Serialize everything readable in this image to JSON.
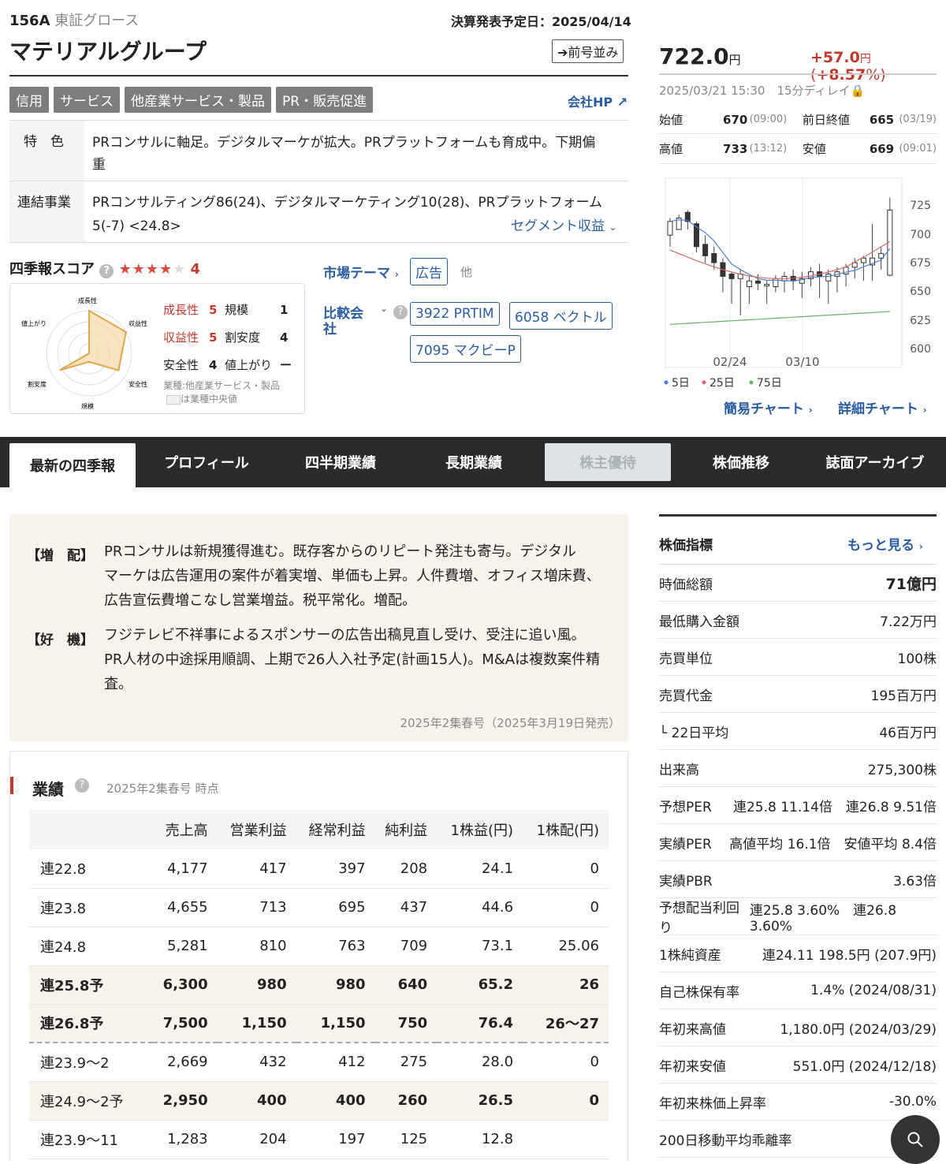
{
  "header": {
    "code": "156A",
    "market": "東証グロース",
    "name": "マテリアルグループ",
    "earnings_date": "決算発表予定日：2025/04/14",
    "prev_issue_btn": "前号並み",
    "tags": [
      "信用",
      "サービス",
      "他産業サービス・製品",
      "PR・販売促進"
    ],
    "company_hp": "会社HP"
  },
  "features": {
    "label": "特　色",
    "text1": "PRコンサルに軸足。デジタルマーケが拡大。PRプラットフォームも育成中。下期偏",
    "text2": "重"
  },
  "business": {
    "label": "連結事業",
    "text1": "PRコンサルティング86(24)、デジタルマーケティング10(28)、PRプラットフォーム",
    "text2": "5(-7) <24.8>",
    "segment_link": "セグメント収益"
  },
  "score": {
    "title": "四季報スコア",
    "total": "4",
    "items": [
      {
        "label": "成長性",
        "val": "5",
        "red": true
      },
      {
        "label": "規模",
        "val": "1"
      },
      {
        "label": "収益性",
        "val": "5",
        "red": true
      },
      {
        "label": "割安度",
        "val": "4"
      },
      {
        "label": "安全性",
        "val": "4"
      },
      {
        "label": "値上がり",
        "val": "ー"
      }
    ],
    "industry": "業種:他産業サービス・製品",
    "median_note": "は業種中央値",
    "radar_labels": {
      "growth": "成長性",
      "profit": "収益性",
      "safety": "安全性",
      "scale": "規模",
      "cheap": "割安度",
      "rise": "値上がり"
    }
  },
  "theme": {
    "label": "市場テーマ",
    "chip": "広告",
    "other": "他"
  },
  "compare": {
    "label1": "比較会",
    "label2": "社",
    "chips": [
      "3922 PRTIM",
      "6058 ベクトル",
      "7095 マクビーP"
    ]
  },
  "price": {
    "value": "722.0",
    "unit": "円",
    "change": "+57.0",
    "change_unit": "円",
    "pct_open": "(",
    "pct": "+8.57",
    "pct_close": "%)",
    "time": "2025/03/21 15:30",
    "delay": "15分ディレイ",
    "open_label": "始値",
    "open": "670",
    "open_time": "(09:00)",
    "prev_label": "前日終値",
    "prev": "665",
    "prev_date": "(03/19)",
    "high_label": "高値",
    "high": "733",
    "high_time": "(13:12)",
    "low_label": "安値",
    "low": "669",
    "low_time": "(09:01)"
  },
  "chart": {
    "y_ticks": [
      "725",
      "700",
      "675",
      "650",
      "625",
      "600"
    ],
    "x_ticks": [
      "02/24",
      "03/10"
    ],
    "legend": [
      "5日",
      "25日",
      "75日"
    ],
    "simple": "簡易チャート",
    "detail": "詳細チャート"
  },
  "tabs": [
    "最新の四季報",
    "プロフィール",
    "四半期業績",
    "長期業績",
    "株主優待",
    "株価推移",
    "誌面アーカイブ"
  ],
  "news": {
    "items": [
      {
        "label": "【増　配】",
        "lines": [
          "PRコンサルは新規獲得進む。既存客からのリピート発注も寄与。デジタル",
          "マーケは広告運用の案件が着実増、単価も上昇。人件費増、オフィス増床費、",
          "広告宣伝費増こなし営業増益。税平常化。増配。"
        ]
      },
      {
        "label": "【好　機】",
        "lines": [
          "フジテレビ不祥事によるスポンサーの広告出稿見直し受け、受注に追い風。",
          "PR人材の中途採用順調、上期で26人入社予定(計画15人)。M&Aは複数案件精",
          "査。"
        ]
      }
    ],
    "issue": "2025年2集春号（2025年3月19日発売）"
  },
  "perf": {
    "title": "業績",
    "as_of": "2025年2集春号 時点",
    "headers": [
      "",
      "売上高",
      "営業利益",
      "経常利益",
      "純利益",
      "1株益(円)",
      "1株配(円)"
    ],
    "rows": [
      [
        "連22.8",
        "4,177",
        "417",
        "397",
        "208",
        "24.1",
        "0"
      ],
      [
        "連23.8",
        "4,655",
        "713",
        "695",
        "437",
        "44.6",
        "0"
      ],
      [
        "連24.8",
        "5,281",
        "810",
        "763",
        "709",
        "73.1",
        "25.06"
      ],
      [
        "連25.8予",
        "6,300",
        "980",
        "980",
        "640",
        "65.2",
        "26"
      ],
      [
        "連26.8予",
        "7,500",
        "1,150",
        "1,150",
        "750",
        "76.4",
        "26～27"
      ],
      [
        "連23.9～2",
        "2,669",
        "432",
        "412",
        "275",
        "28.0",
        "0"
      ],
      [
        "連24.9～2予",
        "2,950",
        "400",
        "400",
        "260",
        "26.5",
        "0"
      ],
      [
        "連23.9～11",
        "1,283",
        "204",
        "197",
        "125",
        "12.8",
        ""
      ]
    ]
  },
  "indicators": {
    "title": "株価指標",
    "more": "もっと見る",
    "rows": [
      {
        "l": "時価総額",
        "v": "71億円"
      },
      {
        "l": "最低購入金額",
        "v": "7.22万円"
      },
      {
        "l": "売買単位",
        "v": "100株"
      },
      {
        "l": "売買代金",
        "v": "195百万円"
      },
      {
        "l": "└ 22日平均",
        "v": "46百万円"
      },
      {
        "l": "出来高",
        "v": "275,300株"
      },
      {
        "l": "予想PER",
        "v": "連25.8 11.14倍　連26.8 9.51倍"
      },
      {
        "l": "実績PER",
        "v": "高値平均 16.1倍　安値平均 8.4倍"
      },
      {
        "l": "実績PBR",
        "v": "3.63倍"
      },
      {
        "l": "予想配当利回り",
        "v": "連25.8 3.60%　連26.8 3.60%"
      },
      {
        "l": "1株純資産",
        "v": "連24.11 198.5円 (207.9円)"
      },
      {
        "l": "自己株保有率",
        "v": "1.4% (2024/08/31)"
      },
      {
        "l": "年初来高値",
        "v": "1,180.0円 (2024/03/29)"
      },
      {
        "l": "年初来安値",
        "v": "551.0円 (2024/12/18)"
      },
      {
        "l": "年初来株価上昇率",
        "v": "-30.0%"
      },
      {
        "l": "200日移動平均乖離率",
        "v": ""
      }
    ]
  }
}
